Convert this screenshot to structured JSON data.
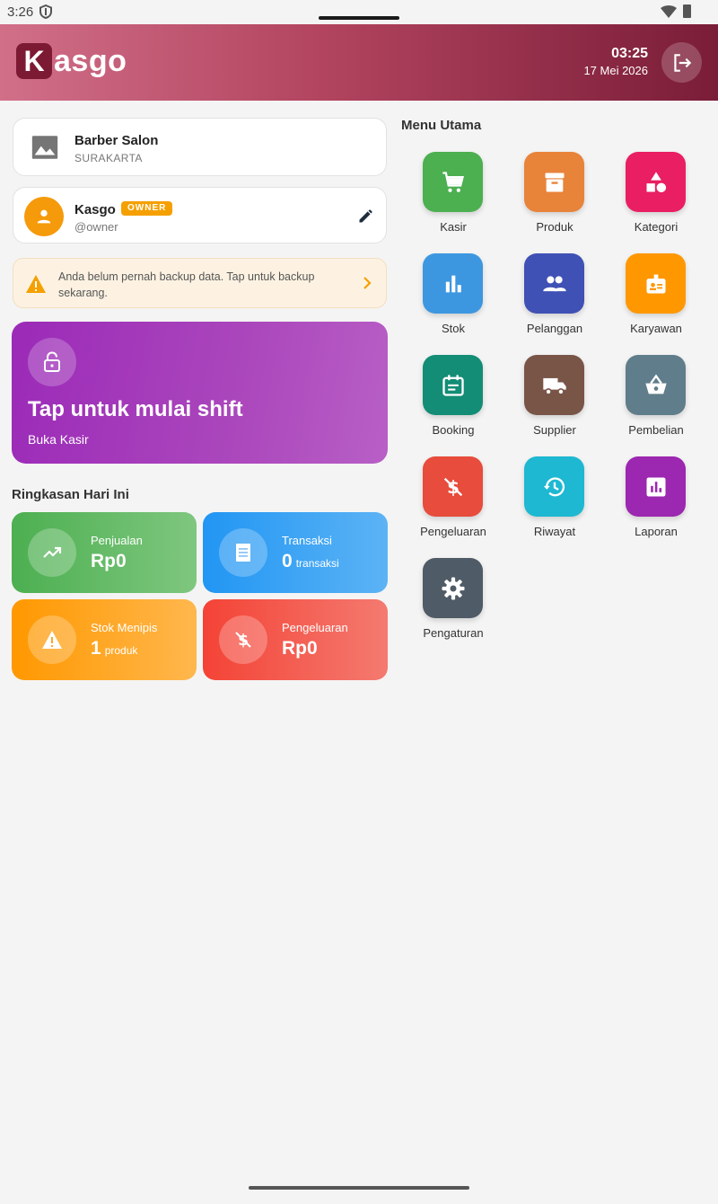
{
  "status_bar": {
    "time": "3:26"
  },
  "header": {
    "logo_k": "K",
    "logo_rest": "asgo",
    "time": "03:25",
    "date": "17 Mei 2026"
  },
  "store": {
    "name": "Barber Salon",
    "city": "SURAKARTA"
  },
  "user": {
    "name": "Kasgo",
    "role_badge": "OWNER",
    "handle": "@owner"
  },
  "backup_notice": {
    "text": "Anda belum pernah backup data. Tap untuk backup sekarang."
  },
  "shift": {
    "title": "Tap untuk mulai shift",
    "subtitle": "Buka Kasir"
  },
  "summary": {
    "title": "Ringkasan Hari Ini",
    "sales": {
      "label": "Penjualan",
      "value": "Rp0"
    },
    "transactions": {
      "label": "Transaksi",
      "value": "0",
      "unit": "transaksi"
    },
    "low_stock": {
      "label": "Stok Menipis",
      "value": "1",
      "unit": "produk"
    },
    "expenses": {
      "label": "Pengeluaran",
      "value": "Rp0"
    }
  },
  "menu": {
    "title": "Menu Utama",
    "items": [
      {
        "label": "Kasir",
        "icon": "cart-icon",
        "color": "#4caf50"
      },
      {
        "label": "Produk",
        "icon": "archive-icon",
        "color": "#e8833a"
      },
      {
        "label": "Kategori",
        "icon": "category-icon",
        "color": "#e91e63"
      },
      {
        "label": "Stok",
        "icon": "bar-chart-icon",
        "color": "#3d97e0"
      },
      {
        "label": "Pelanggan",
        "icon": "people-icon",
        "color": "#3f51b5"
      },
      {
        "label": "Karyawan",
        "icon": "badge-icon",
        "color": "#ff9800"
      },
      {
        "label": "Booking",
        "icon": "calendar-icon",
        "color": "#138d75"
      },
      {
        "label": "Supplier",
        "icon": "truck-icon",
        "color": "#795548"
      },
      {
        "label": "Pembelian",
        "icon": "basket-icon",
        "color": "#607d8b"
      },
      {
        "label": "Pengeluaran",
        "icon": "money-off-icon",
        "color": "#e74c3c"
      },
      {
        "label": "Riwayat",
        "icon": "history-icon",
        "color": "#1eb8d2"
      },
      {
        "label": "Laporan",
        "icon": "report-icon",
        "color": "#9c27b0"
      },
      {
        "label": "Pengaturan",
        "icon": "gear-icon",
        "color": "#4f5b66"
      }
    ]
  }
}
